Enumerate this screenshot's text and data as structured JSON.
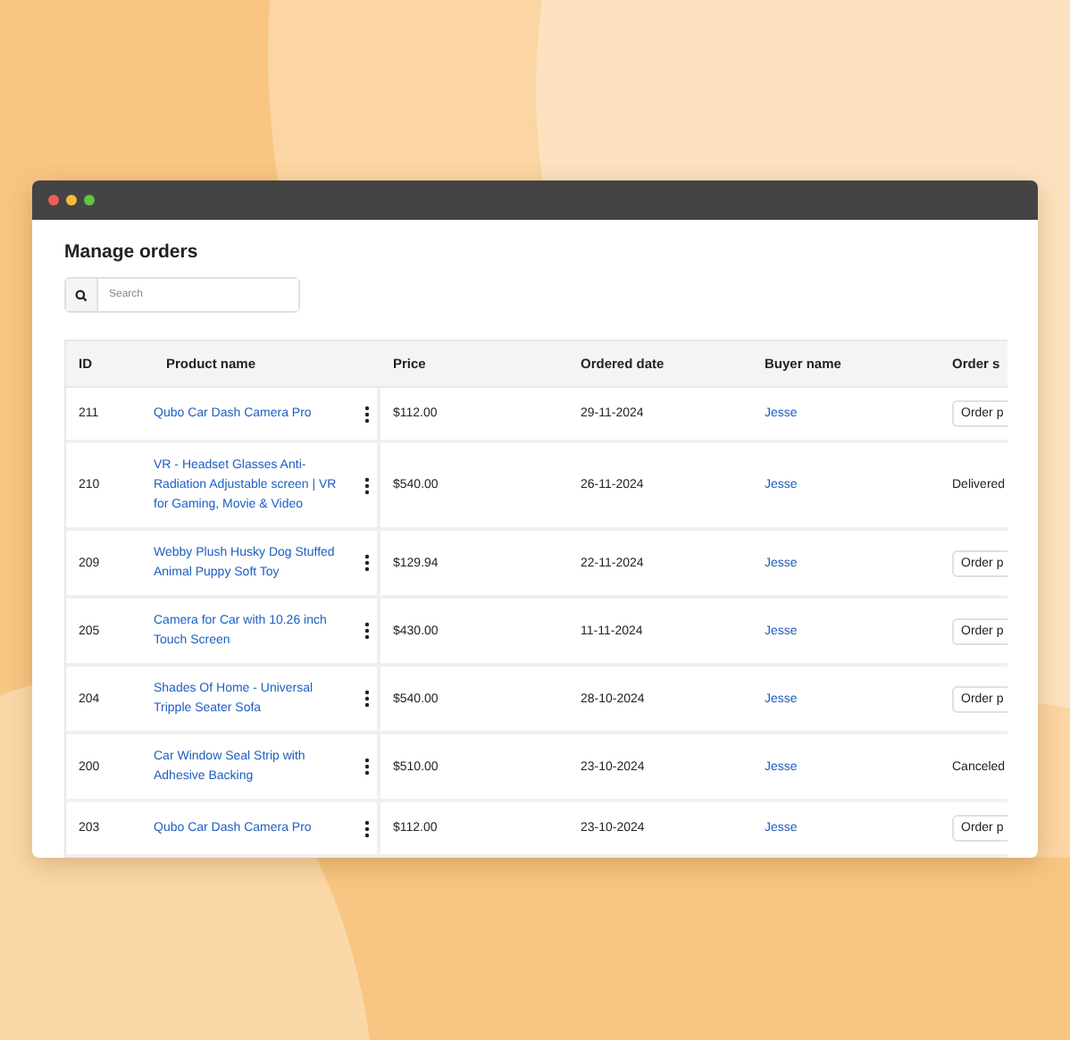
{
  "page": {
    "title": "Manage orders"
  },
  "search": {
    "placeholder": "Search"
  },
  "table": {
    "columns": [
      "ID",
      "Product name",
      "Price",
      "Ordered date",
      "Buyer name",
      "Order s"
    ],
    "rows": [
      {
        "id": "211",
        "product": "Qubo Car Dash Camera Pro",
        "price": "$112.00",
        "date": "29-11-2024",
        "buyer": "Jesse",
        "status": {
          "kind": "dropdown",
          "text": "Order p"
        }
      },
      {
        "id": "210",
        "product": "VR - Headset Glasses Anti-Radiation Adjustable screen | VR for Gaming, Movie & Video",
        "price": "$540.00",
        "date": "26-11-2024",
        "buyer": "Jesse",
        "status": {
          "kind": "text",
          "text": "Delivered"
        }
      },
      {
        "id": "209",
        "product": "Webby Plush Husky Dog Stuffed Animal Puppy Soft Toy",
        "price": "$129.94",
        "date": "22-11-2024",
        "buyer": "Jesse",
        "status": {
          "kind": "dropdown",
          "text": "Order p"
        }
      },
      {
        "id": "205",
        "product": "Camera for Car with 10.26 inch Touch Screen",
        "price": "$430.00",
        "date": "11-11-2024",
        "buyer": "Jesse",
        "status": {
          "kind": "dropdown",
          "text": "Order p"
        }
      },
      {
        "id": "204",
        "product": "Shades Of Home - Universal Tripple Seater Sofa",
        "price": "$540.00",
        "date": "28-10-2024",
        "buyer": "Jesse",
        "status": {
          "kind": "dropdown",
          "text": "Order p"
        }
      },
      {
        "id": "200",
        "product": "Car Window Seal Strip with Adhesive Backing",
        "price": "$510.00",
        "date": "23-10-2024",
        "buyer": "Jesse",
        "status": {
          "kind": "text",
          "text": "Canceled"
        }
      },
      {
        "id": "203",
        "product": "Qubo Car Dash Camera Pro",
        "price": "$112.00",
        "date": "23-10-2024",
        "buyer": "Jesse",
        "status": {
          "kind": "dropdown",
          "text": "Order p"
        }
      }
    ]
  }
}
